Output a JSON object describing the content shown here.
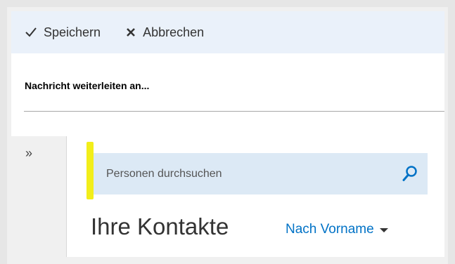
{
  "toolbar": {
    "save_label": "Speichern",
    "cancel_label": "Abbrechen",
    "save_icon": "checkmark-icon",
    "cancel_icon": "close-icon"
  },
  "header": {
    "title": "Nachricht weiterleiten an..."
  },
  "left_rail": {
    "expand_glyph": "»"
  },
  "search": {
    "placeholder": "Personen durchsuchen",
    "value": "",
    "icon": "search-icon"
  },
  "contacts": {
    "heading": "Ihre Kontakte",
    "sort_label": "Nach Vorname"
  },
  "colors": {
    "accent": "#0072c6",
    "toolbar_bg": "#eaf1fa",
    "search_bg": "#dce9f5",
    "highlight": "#f2ee1a"
  }
}
